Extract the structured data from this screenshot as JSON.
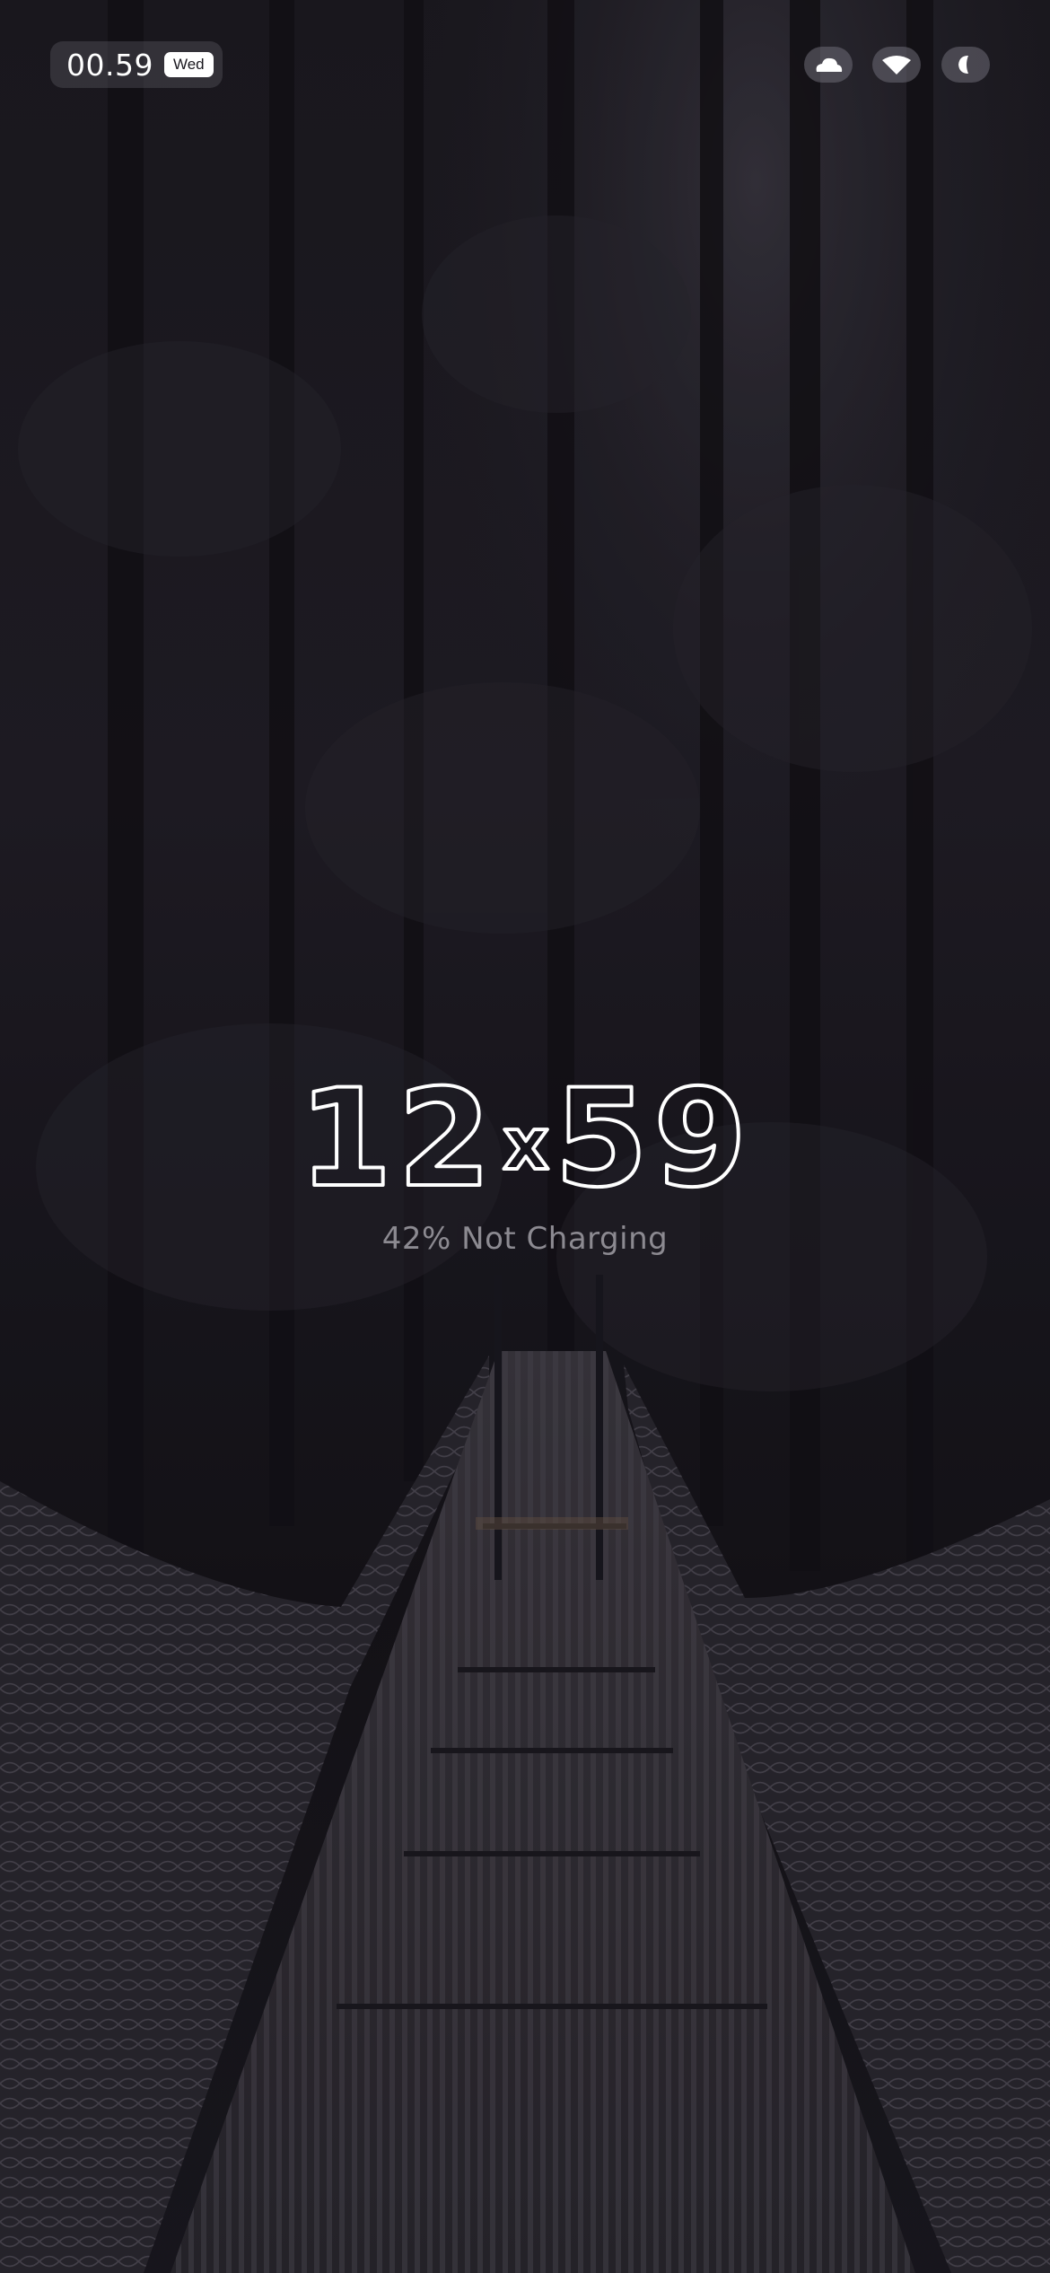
{
  "status_bar": {
    "time": "00.59",
    "day": "Wed",
    "icons": [
      "cloud-icon",
      "wifi-icon",
      "battery-icon"
    ]
  },
  "lockscreen": {
    "clock_hours": "12",
    "clock_separator": "x",
    "clock_minutes": "59",
    "battery_text": "42% Not Charging"
  },
  "wallpaper": {
    "name": "forest-suspension-bridge",
    "colors": {
      "sky": "#201d26",
      "foliage": "#1c1a21",
      "bridge": "#3a3640",
      "accent": "#5a4a42"
    }
  }
}
